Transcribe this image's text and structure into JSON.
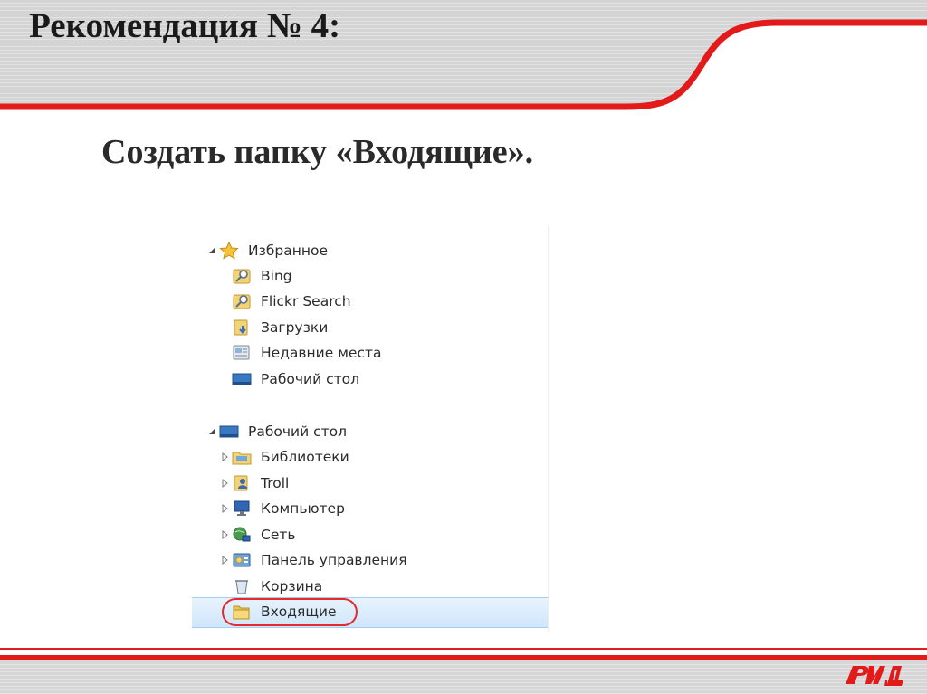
{
  "slide": {
    "title": "Рекомендация № 4:",
    "subtitle": "Создать папку «Входящие»."
  },
  "explorer": {
    "favorites": {
      "label": "Избранное",
      "icon": "star-icon",
      "items": [
        {
          "label": "Bing",
          "icon": "search-folder-icon"
        },
        {
          "label": "Flickr Search",
          "icon": "search-folder-icon"
        },
        {
          "label": "Загрузки",
          "icon": "downloads-folder-icon"
        },
        {
          "label": "Недавние места",
          "icon": "recent-places-icon"
        },
        {
          "label": "Рабочий стол",
          "icon": "desktop-icon"
        }
      ]
    },
    "desktop": {
      "label": "Рабочий стол",
      "icon": "desktop-icon",
      "items": [
        {
          "label": "Библиотеки",
          "icon": "libraries-icon",
          "expandable": true
        },
        {
          "label": "Troll",
          "icon": "user-folder-icon",
          "expandable": true
        },
        {
          "label": "Компьютер",
          "icon": "computer-icon",
          "expandable": true
        },
        {
          "label": "Сеть",
          "icon": "network-icon",
          "expandable": true
        },
        {
          "label": "Панель управления",
          "icon": "control-panel-icon",
          "expandable": true
        },
        {
          "label": "Корзина",
          "icon": "recycle-bin-icon",
          "expandable": false
        },
        {
          "label": "Входящие",
          "icon": "folder-icon",
          "expandable": false,
          "selected": true
        }
      ]
    }
  },
  "colors": {
    "accent_red": "#e21a1a",
    "selection_blue": "#cfe6fb",
    "highlight_ring": "#e42a2a"
  },
  "brand": {
    "logo": "rzd-logo"
  }
}
